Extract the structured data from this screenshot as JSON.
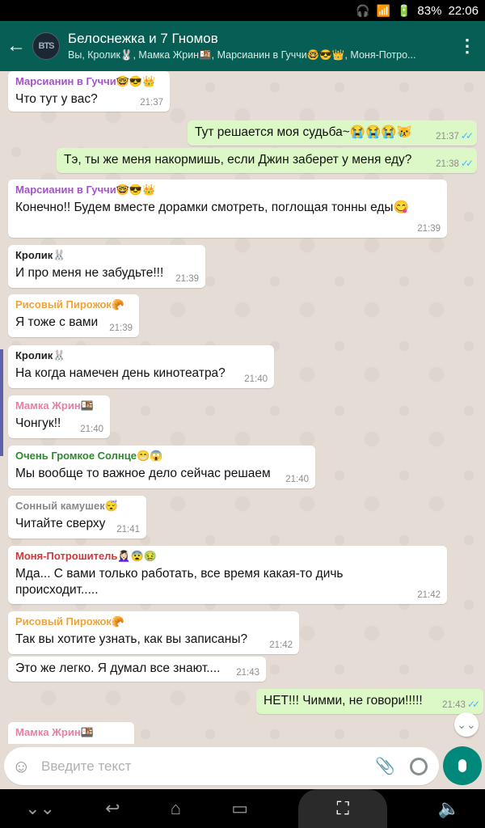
{
  "status_bar": {
    "battery": "83%",
    "time": "22:06"
  },
  "header": {
    "back_icon": "←",
    "avatar_text": "BTS",
    "title": "Белоснежка и 7 Гномов",
    "subtitle": "Вы, Кролик🐰, Мамка Жрин🍱, Марсианин в Гуччи🤓😎👑, Моня-Потро...",
    "menu_icon": "⋮"
  },
  "colors": {
    "app_bar": "#075e54",
    "outgoing_bubble": "#dcf8c6",
    "incoming_bubble": "#ffffff",
    "ticks": "#4fb6ec",
    "mic_button": "#00897b"
  },
  "messages": [
    {
      "sender": "Марсианин в Гуччи🤓😎👑",
      "text": "Что тут у вас?",
      "time": "21:37"
    },
    {
      "text": "Тут решается моя судьба~😭😭😭😿",
      "time": "21:37",
      "ticks": "✓✓"
    },
    {
      "text": "Тэ, ты же меня накормишь, если Джин заберет у меня еду?",
      "time": "21:38",
      "ticks": "✓✓"
    },
    {
      "sender": "Марсианин в Гуччи🤓😎👑",
      "text": "Конечно!! Будем вместе дорамки смотреть, поглощая тонны еды😋",
      "time": "21:39"
    },
    {
      "sender": "Кролик🐰",
      "text": "И про меня не забудьте!!!",
      "time": "21:39"
    },
    {
      "sender": "Рисовый Пирожок🥐",
      "text": "Я тоже с вами",
      "time": "21:39"
    },
    {
      "sender": "Кролик🐰",
      "text": "На когда намечен день кинотеатра?",
      "time": "21:40"
    },
    {
      "sender": "Мамка Жрин🍱",
      "text": "Чонгук!!",
      "time": "21:40"
    },
    {
      "sender": "Очень Громкое Солнце😁😱",
      "text": "Мы вообще то важное дело сейчас решаем",
      "time": "21:40"
    },
    {
      "sender": "Сонный камушек😴",
      "text": "Читайте сверху",
      "time": "21:41"
    },
    {
      "sender": "Моня-Потрошитель💆🏻‍♀️😨🤢",
      "text": "Мда... С вами только работать, все время какая-то дичь происходит.....",
      "time": "21:42"
    },
    {
      "sender": "Рисовый Пирожок🥐",
      "text": "Так вы хотите узнать, как вы записаны?",
      "time": "21:42"
    },
    {
      "text": "Это же легко. Я думал все знают....",
      "time": "21:43"
    },
    {
      "text": "НЕТ!!! Чимми, не говори!!!!!",
      "time": "21:43",
      "ticks": "✓✓"
    },
    {
      "sender": "Мамка Жрин🍱"
    }
  ],
  "input": {
    "placeholder": "Введите текст",
    "emoji_icon": "☺",
    "attach_icon": "📎"
  },
  "scroll_icon": "⌄⌄",
  "nav": {
    "recents": "⌄⌄",
    "back": "↩",
    "home": "⌂",
    "apps": "▭",
    "screenshot": "⛶",
    "volume": "🔈"
  }
}
